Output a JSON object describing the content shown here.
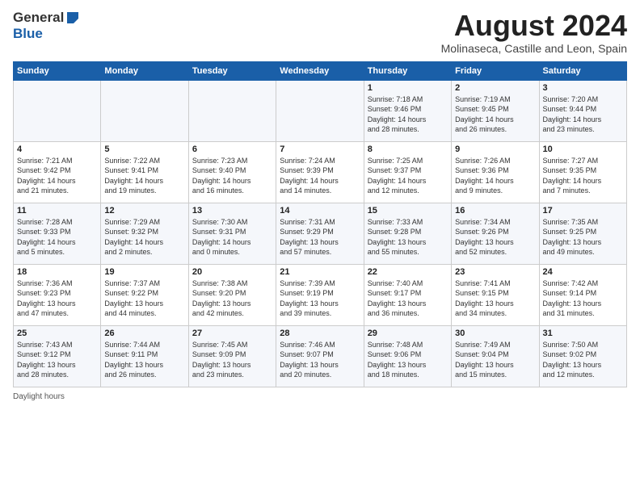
{
  "logo": {
    "general": "General",
    "blue": "Blue"
  },
  "title": "August 2024",
  "subtitle": "Molinaseca, Castille and Leon, Spain",
  "days_of_week": [
    "Sunday",
    "Monday",
    "Tuesday",
    "Wednesday",
    "Thursday",
    "Friday",
    "Saturday"
  ],
  "weeks": [
    [
      {
        "day": "",
        "info": ""
      },
      {
        "day": "",
        "info": ""
      },
      {
        "day": "",
        "info": ""
      },
      {
        "day": "",
        "info": ""
      },
      {
        "day": "1",
        "info": "Sunrise: 7:18 AM\nSunset: 9:46 PM\nDaylight: 14 hours\nand 28 minutes."
      },
      {
        "day": "2",
        "info": "Sunrise: 7:19 AM\nSunset: 9:45 PM\nDaylight: 14 hours\nand 26 minutes."
      },
      {
        "day": "3",
        "info": "Sunrise: 7:20 AM\nSunset: 9:44 PM\nDaylight: 14 hours\nand 23 minutes."
      }
    ],
    [
      {
        "day": "4",
        "info": "Sunrise: 7:21 AM\nSunset: 9:42 PM\nDaylight: 14 hours\nand 21 minutes."
      },
      {
        "day": "5",
        "info": "Sunrise: 7:22 AM\nSunset: 9:41 PM\nDaylight: 14 hours\nand 19 minutes."
      },
      {
        "day": "6",
        "info": "Sunrise: 7:23 AM\nSunset: 9:40 PM\nDaylight: 14 hours\nand 16 minutes."
      },
      {
        "day": "7",
        "info": "Sunrise: 7:24 AM\nSunset: 9:39 PM\nDaylight: 14 hours\nand 14 minutes."
      },
      {
        "day": "8",
        "info": "Sunrise: 7:25 AM\nSunset: 9:37 PM\nDaylight: 14 hours\nand 12 minutes."
      },
      {
        "day": "9",
        "info": "Sunrise: 7:26 AM\nSunset: 9:36 PM\nDaylight: 14 hours\nand 9 minutes."
      },
      {
        "day": "10",
        "info": "Sunrise: 7:27 AM\nSunset: 9:35 PM\nDaylight: 14 hours\nand 7 minutes."
      }
    ],
    [
      {
        "day": "11",
        "info": "Sunrise: 7:28 AM\nSunset: 9:33 PM\nDaylight: 14 hours\nand 5 minutes."
      },
      {
        "day": "12",
        "info": "Sunrise: 7:29 AM\nSunset: 9:32 PM\nDaylight: 14 hours\nand 2 minutes."
      },
      {
        "day": "13",
        "info": "Sunrise: 7:30 AM\nSunset: 9:31 PM\nDaylight: 14 hours\nand 0 minutes."
      },
      {
        "day": "14",
        "info": "Sunrise: 7:31 AM\nSunset: 9:29 PM\nDaylight: 13 hours\nand 57 minutes."
      },
      {
        "day": "15",
        "info": "Sunrise: 7:33 AM\nSunset: 9:28 PM\nDaylight: 13 hours\nand 55 minutes."
      },
      {
        "day": "16",
        "info": "Sunrise: 7:34 AM\nSunset: 9:26 PM\nDaylight: 13 hours\nand 52 minutes."
      },
      {
        "day": "17",
        "info": "Sunrise: 7:35 AM\nSunset: 9:25 PM\nDaylight: 13 hours\nand 49 minutes."
      }
    ],
    [
      {
        "day": "18",
        "info": "Sunrise: 7:36 AM\nSunset: 9:23 PM\nDaylight: 13 hours\nand 47 minutes."
      },
      {
        "day": "19",
        "info": "Sunrise: 7:37 AM\nSunset: 9:22 PM\nDaylight: 13 hours\nand 44 minutes."
      },
      {
        "day": "20",
        "info": "Sunrise: 7:38 AM\nSunset: 9:20 PM\nDaylight: 13 hours\nand 42 minutes."
      },
      {
        "day": "21",
        "info": "Sunrise: 7:39 AM\nSunset: 9:19 PM\nDaylight: 13 hours\nand 39 minutes."
      },
      {
        "day": "22",
        "info": "Sunrise: 7:40 AM\nSunset: 9:17 PM\nDaylight: 13 hours\nand 36 minutes."
      },
      {
        "day": "23",
        "info": "Sunrise: 7:41 AM\nSunset: 9:15 PM\nDaylight: 13 hours\nand 34 minutes."
      },
      {
        "day": "24",
        "info": "Sunrise: 7:42 AM\nSunset: 9:14 PM\nDaylight: 13 hours\nand 31 minutes."
      }
    ],
    [
      {
        "day": "25",
        "info": "Sunrise: 7:43 AM\nSunset: 9:12 PM\nDaylight: 13 hours\nand 28 minutes."
      },
      {
        "day": "26",
        "info": "Sunrise: 7:44 AM\nSunset: 9:11 PM\nDaylight: 13 hours\nand 26 minutes."
      },
      {
        "day": "27",
        "info": "Sunrise: 7:45 AM\nSunset: 9:09 PM\nDaylight: 13 hours\nand 23 minutes."
      },
      {
        "day": "28",
        "info": "Sunrise: 7:46 AM\nSunset: 9:07 PM\nDaylight: 13 hours\nand 20 minutes."
      },
      {
        "day": "29",
        "info": "Sunrise: 7:48 AM\nSunset: 9:06 PM\nDaylight: 13 hours\nand 18 minutes."
      },
      {
        "day": "30",
        "info": "Sunrise: 7:49 AM\nSunset: 9:04 PM\nDaylight: 13 hours\nand 15 minutes."
      },
      {
        "day": "31",
        "info": "Sunrise: 7:50 AM\nSunset: 9:02 PM\nDaylight: 13 hours\nand 12 minutes."
      }
    ]
  ],
  "footer": "Daylight hours"
}
